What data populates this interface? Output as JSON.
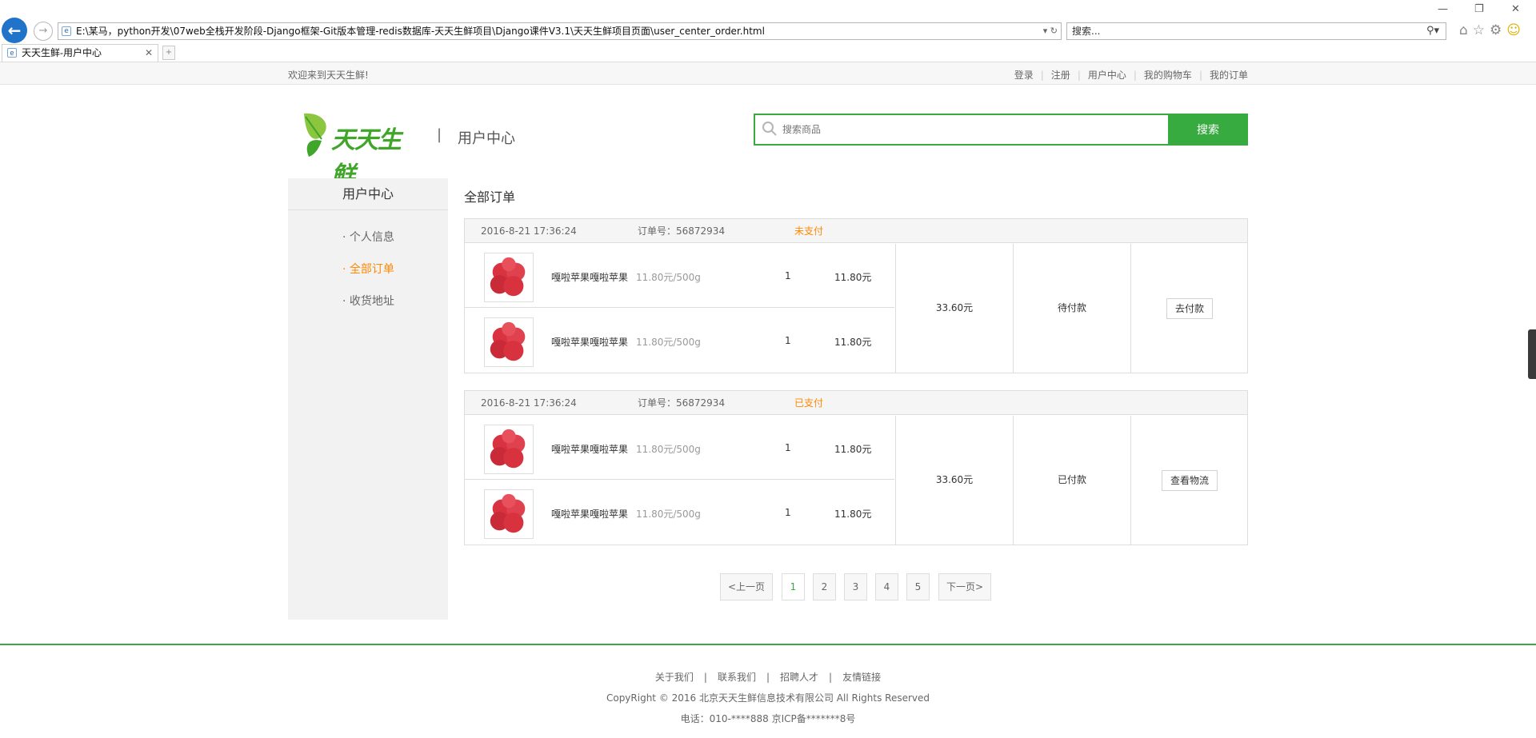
{
  "browser": {
    "address": "E:\\某马，python开发\\07web全栈开发阶段-Django框架-Git版本管理-redis数据库-天天生鲜项目\\Django课件V3.1\\天天生鲜项目页面\\user_center_order.html",
    "search_placeholder": "搜索...",
    "tab_title": "天天生鲜-用户中心"
  },
  "topbar": {
    "welcome": "欢迎来到天天生鲜!",
    "links": [
      "登录",
      "注册",
      "用户中心",
      "我的购物车",
      "我的订单"
    ]
  },
  "header": {
    "logo_text": "天天生鲜",
    "separator": "|",
    "title": "用户中心",
    "search_placeholder": "搜索商品",
    "search_button": "搜索"
  },
  "sidebar": {
    "title": "用户中心",
    "items": [
      {
        "label": "· 个人信息",
        "active": false
      },
      {
        "label": "· 全部订单",
        "active": true
      },
      {
        "label": "· 收货地址",
        "active": false
      }
    ]
  },
  "main": {
    "title": "全部订单",
    "orders": [
      {
        "time": "2016-8-21 17:36:24",
        "order_no": "订单号：56872934",
        "status": "未支付",
        "goods": [
          {
            "name": "嘎啦苹果嘎啦苹果",
            "price": "11.80元/500g",
            "qty": "1",
            "subtotal": "11.80元"
          },
          {
            "name": "嘎啦苹果嘎啦苹果",
            "price": "11.80元/500g",
            "qty": "1",
            "subtotal": "11.80元"
          }
        ],
        "total": "33.60元",
        "pay_state": "待付款",
        "action": "去付款"
      },
      {
        "time": "2016-8-21 17:36:24",
        "order_no": "订单号：56872934",
        "status": "已支付",
        "goods": [
          {
            "name": "嘎啦苹果嘎啦苹果",
            "price": "11.80元/500g",
            "qty": "1",
            "subtotal": "11.80元"
          },
          {
            "name": "嘎啦苹果嘎啦苹果",
            "price": "11.80元/500g",
            "qty": "1",
            "subtotal": "11.80元"
          }
        ],
        "total": "33.60元",
        "pay_state": "已付款",
        "action": "查看物流"
      }
    ]
  },
  "pagination": {
    "prev": "<上一页",
    "pages": [
      "1",
      "2",
      "3",
      "4",
      "5"
    ],
    "current": "1",
    "next": "下一页>"
  },
  "footer": {
    "links": [
      "关于我们",
      "联系我们",
      "招聘人才",
      "友情链接"
    ],
    "separator": "|",
    "copyright": "CopyRight © 2016 北京天天生鲜信息技术有限公司 All Rights Reserved",
    "tel": "电话：010-****888 京ICP备*******8号"
  },
  "colors": {
    "brand_green": "#37ab40",
    "accent_orange": "#ff8800"
  }
}
